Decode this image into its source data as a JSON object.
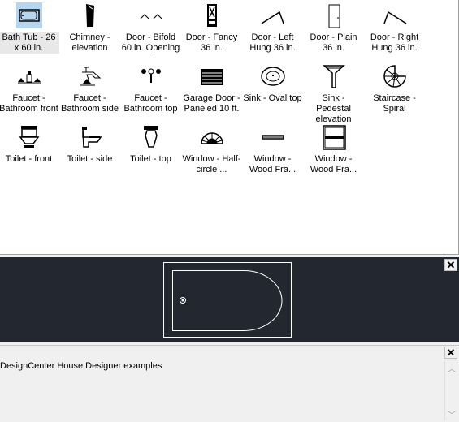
{
  "items": [
    {
      "label": "Bath Tub - 26 x 60 in.",
      "icon": "bathtub-icon",
      "selected": true
    },
    {
      "label": "Chimney - elevation",
      "icon": "chimney-icon"
    },
    {
      "label": "Door - Bifold 60 in. Opening",
      "icon": "door-bifold-icon"
    },
    {
      "label": "Door - Fancy 36 in.",
      "icon": "door-fancy-icon"
    },
    {
      "label": "Door - Left Hung 36 in.",
      "icon": "door-left-icon"
    },
    {
      "label": "Door - Plain 36 in.",
      "icon": "door-plain-icon"
    },
    {
      "label": "Door - Right Hung 36 in.",
      "icon": "door-right-icon"
    },
    {
      "label": "Faucet - Bathroom front",
      "icon": "faucet-front-icon"
    },
    {
      "label": "Faucet - Bathroom side",
      "icon": "faucet-side-icon"
    },
    {
      "label": "Faucet - Bathroom top",
      "icon": "faucet-top-icon"
    },
    {
      "label": "Garage Door - Paneled 10 ft.",
      "icon": "garage-door-icon"
    },
    {
      "label": "Sink - Oval top",
      "icon": "sink-oval-icon"
    },
    {
      "label": "Sink - Pedestal elevation",
      "icon": "sink-pedestal-icon"
    },
    {
      "label": "Staircase - Spiral",
      "icon": "staircase-icon"
    },
    {
      "label": "Toilet - front",
      "icon": "toilet-front-icon"
    },
    {
      "label": "Toilet - side",
      "icon": "toilet-side-icon"
    },
    {
      "label": "Toilet - top",
      "icon": "toilet-top-icon"
    },
    {
      "label": "Window - Half-circle ...",
      "icon": "window-halfcircle-icon"
    },
    {
      "label": "Window - Wood Fra...",
      "icon": "window-wood-icon"
    },
    {
      "label": "Window - Wood Fra...",
      "icon": "window-wood2-icon"
    }
  ],
  "preview": {
    "background": "#232830",
    "close": "✕"
  },
  "description": {
    "text": "DesignCenter House Designer examples",
    "close": "✕"
  }
}
